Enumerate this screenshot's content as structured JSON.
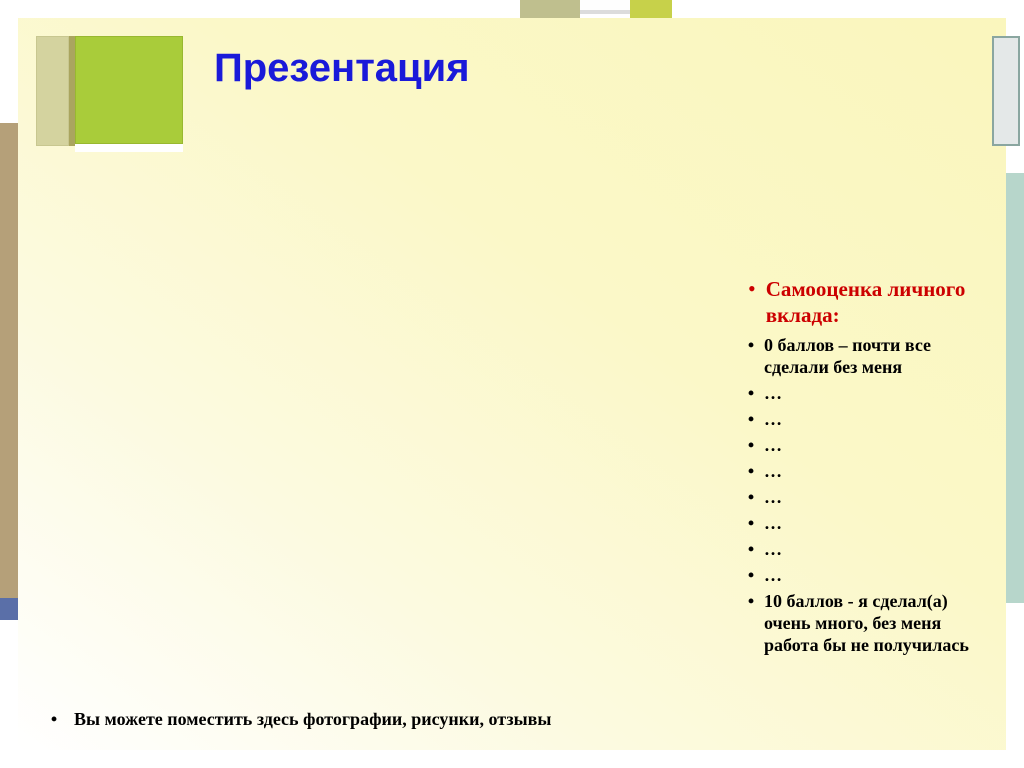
{
  "slide": {
    "title": "Презентация",
    "self_assessment": {
      "heading": "Самооценка личного вклада:",
      "items": [
        "0 баллов – почти все сделали без меня",
        "…",
        "…",
        "…",
        "…",
        "…",
        "…",
        "…",
        "…",
        "10 баллов - я сделал(а) очень много, без меня работа бы не получилась"
      ]
    },
    "footer": "Вы можете поместить здесь фотографии, рисунки, отзывы"
  }
}
